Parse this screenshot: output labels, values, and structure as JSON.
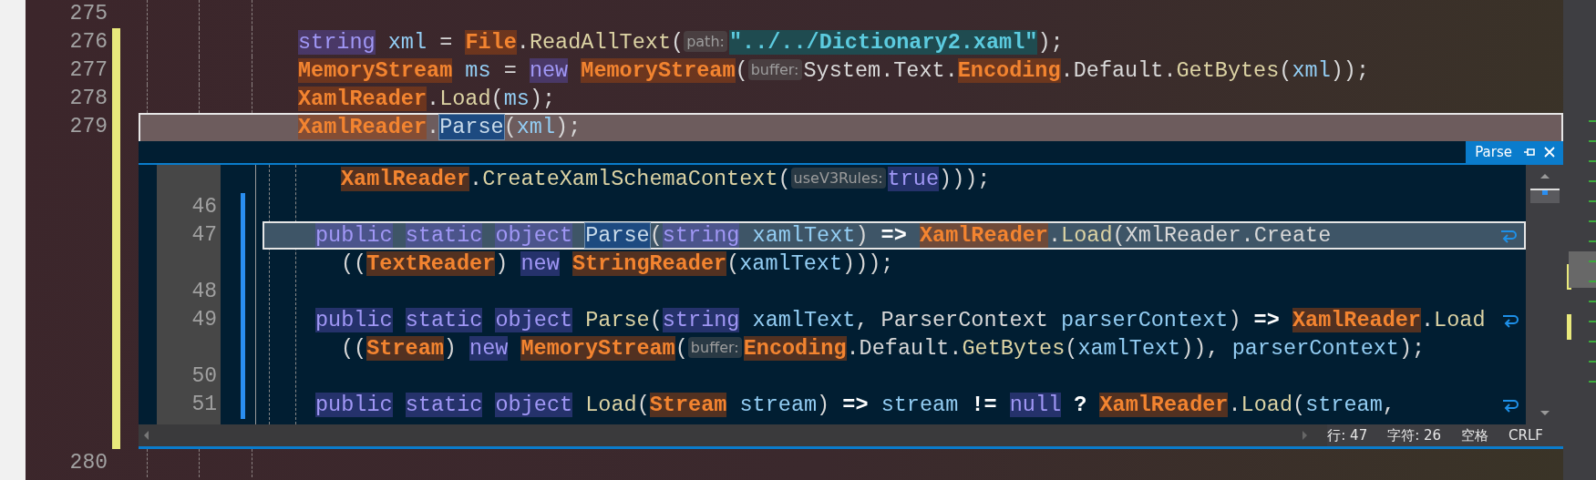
{
  "editor": {
    "lines": [
      {
        "number": "275",
        "changed": false,
        "selected": false
      },
      {
        "number": "276",
        "changed": true,
        "selected": false,
        "tokens": [
          {
            "text": "string ",
            "kind": "kw"
          },
          {
            "text": "xml",
            "kind": "var"
          },
          {
            "text": " = ",
            "kind": "plain"
          },
          {
            "text": "File",
            "kind": "type"
          },
          {
            "text": ".",
            "kind": "plain"
          },
          {
            "text": "ReadAllText",
            "kind": "method"
          },
          {
            "text": "(",
            "kind": "plain"
          },
          {
            "text": "path:",
            "kind": "hint"
          },
          {
            "text": "\"../../Dictionary2.xaml\"",
            "kind": "str"
          },
          {
            "text": ");",
            "kind": "plain"
          }
        ]
      },
      {
        "number": "277",
        "changed": true,
        "selected": false,
        "tokens": [
          {
            "text": "MemoryStream ",
            "kind": "type"
          },
          {
            "text": "ms",
            "kind": "var"
          },
          {
            "text": " = ",
            "kind": "plain"
          },
          {
            "text": "new ",
            "kind": "kw"
          },
          {
            "text": "MemoryStream",
            "kind": "type"
          },
          {
            "text": "(",
            "kind": "plain"
          },
          {
            "text": "buffer:",
            "kind": "hint"
          },
          {
            "text": "System.Text.",
            "kind": "plain"
          },
          {
            "text": "Encoding",
            "kind": "type"
          },
          {
            "text": ".Default.",
            "kind": "plain"
          },
          {
            "text": "GetBytes",
            "kind": "method"
          },
          {
            "text": "(",
            "kind": "plain"
          },
          {
            "text": "xml",
            "kind": "var"
          },
          {
            "text": "));",
            "kind": "plain"
          }
        ]
      },
      {
        "number": "278",
        "changed": true,
        "selected": false,
        "tokens": [
          {
            "text": "XamlReader",
            "kind": "type"
          },
          {
            "text": ".",
            "kind": "plain"
          },
          {
            "text": "Load",
            "kind": "method"
          },
          {
            "text": "(",
            "kind": "plain"
          },
          {
            "text": "ms",
            "kind": "var"
          },
          {
            "text": ");",
            "kind": "plain"
          }
        ]
      },
      {
        "number": "279",
        "changed": true,
        "selected": true,
        "tokens": [
          {
            "text": "XamlReader",
            "kind": "type"
          },
          {
            "text": ".",
            "kind": "plain"
          },
          {
            "text": "Parse",
            "kind": "ref"
          },
          {
            "text": "(",
            "kind": "plain"
          },
          {
            "text": "xml",
            "kind": "var"
          },
          {
            "text": ");",
            "kind": "plain"
          }
        ]
      }
    ],
    "peek": {
      "tab": {
        "label": "Parse"
      },
      "rows": [
        {
          "wrapped": true,
          "changed": false,
          "selected": false,
          "wraps": false,
          "tokens": [
            {
              "text": "XamlReader",
              "kind": "type"
            },
            {
              "text": ".",
              "kind": "plain"
            },
            {
              "text": "CreateXamlSchemaContext",
              "kind": "method"
            },
            {
              "text": "(",
              "kind": "plain"
            },
            {
              "text": "useV3Rules:",
              "kind": "hint"
            },
            {
              "text": "true",
              "kind": "kw"
            },
            {
              "text": ")));",
              "kind": "plain"
            }
          ]
        },
        {
          "number": "46",
          "changed": true,
          "selected": false
        },
        {
          "number": "47",
          "wrapped": false,
          "changed": true,
          "selected": true,
          "wraps": true,
          "tokens": [
            {
              "text": "public ",
              "kind": "kw"
            },
            {
              "text": "static ",
              "kind": "kw"
            },
            {
              "text": "object ",
              "kind": "kw"
            },
            {
              "text": "Parse",
              "kind": "ref"
            },
            {
              "text": "(",
              "kind": "plain"
            },
            {
              "text": "string ",
              "kind": "kw"
            },
            {
              "text": "xamlText",
              "kind": "var"
            },
            {
              "text": ") ",
              "kind": "plain"
            },
            {
              "text": "=> ",
              "kind": "op"
            },
            {
              "text": "XamlReader",
              "kind": "type"
            },
            {
              "text": ".",
              "kind": "plain"
            },
            {
              "text": "Load",
              "kind": "method"
            },
            {
              "text": "(XmlReader.Create",
              "kind": "plain"
            }
          ]
        },
        {
          "wrapped": true,
          "changed": true,
          "selected": false,
          "wraps": false,
          "tokens": [
            {
              "text": "((",
              "kind": "plain"
            },
            {
              "text": "TextReader",
              "kind": "type"
            },
            {
              "text": ") ",
              "kind": "plain"
            },
            {
              "text": "new ",
              "kind": "kw"
            },
            {
              "text": "StringReader",
              "kind": "type"
            },
            {
              "text": "(",
              "kind": "plain"
            },
            {
              "text": "xamlText",
              "kind": "var"
            },
            {
              "text": ")));",
              "kind": "plain"
            }
          ]
        },
        {
          "number": "48",
          "changed": true,
          "selected": false
        },
        {
          "number": "49",
          "wrapped": false,
          "changed": true,
          "selected": false,
          "wraps": true,
          "tokens": [
            {
              "text": "public ",
              "kind": "kw"
            },
            {
              "text": "static ",
              "kind": "kw"
            },
            {
              "text": "object ",
              "kind": "kw"
            },
            {
              "text": "Parse",
              "kind": "method"
            },
            {
              "text": "(",
              "kind": "plain"
            },
            {
              "text": "string ",
              "kind": "kw"
            },
            {
              "text": "xamlText",
              "kind": "var"
            },
            {
              "text": ", ParserContext ",
              "kind": "plain"
            },
            {
              "text": "parserContext",
              "kind": "var"
            },
            {
              "text": ") ",
              "kind": "plain"
            },
            {
              "text": "=> ",
              "kind": "op"
            },
            {
              "text": "XamlReader",
              "kind": "type"
            },
            {
              "text": ".",
              "kind": "plain"
            },
            {
              "text": "Load",
              "kind": "method"
            }
          ]
        },
        {
          "wrapped": true,
          "changed": true,
          "selected": false,
          "wraps": false,
          "tokens": [
            {
              "text": "((",
              "kind": "plain"
            },
            {
              "text": "Stream",
              "kind": "type"
            },
            {
              "text": ") ",
              "kind": "plain"
            },
            {
              "text": "new ",
              "kind": "kw"
            },
            {
              "text": "MemoryStream",
              "kind": "type"
            },
            {
              "text": "(",
              "kind": "plain"
            },
            {
              "text": "buffer:",
              "kind": "hint"
            },
            {
              "text": "Encoding",
              "kind": "type"
            },
            {
              "text": ".Default.",
              "kind": "plain"
            },
            {
              "text": "GetBytes",
              "kind": "method"
            },
            {
              "text": "(",
              "kind": "plain"
            },
            {
              "text": "xamlText",
              "kind": "var"
            },
            {
              "text": ")), ",
              "kind": "plain"
            },
            {
              "text": "parserContext",
              "kind": "var"
            },
            {
              "text": ");",
              "kind": "plain"
            }
          ]
        },
        {
          "number": "50",
          "changed": true,
          "selected": false
        },
        {
          "number": "51",
          "wrapped": false,
          "changed": true,
          "selected": false,
          "wraps": true,
          "tokens": [
            {
              "text": "public ",
              "kind": "kw"
            },
            {
              "text": "static ",
              "kind": "kw"
            },
            {
              "text": "object ",
              "kind": "kw"
            },
            {
              "text": "Load",
              "kind": "method"
            },
            {
              "text": "(",
              "kind": "plain"
            },
            {
              "text": "Stream ",
              "kind": "type"
            },
            {
              "text": "stream",
              "kind": "var"
            },
            {
              "text": ") ",
              "kind": "plain"
            },
            {
              "text": "=> ",
              "kind": "op"
            },
            {
              "text": "stream ",
              "kind": "var"
            },
            {
              "text": "!= ",
              "kind": "op"
            },
            {
              "text": "null ",
              "kind": "kw"
            },
            {
              "text": "? ",
              "kind": "op"
            },
            {
              "text": "XamlReader",
              "kind": "type"
            },
            {
              "text": ".",
              "kind": "plain"
            },
            {
              "text": "Load",
              "kind": "method"
            },
            {
              "text": "(",
              "kind": "plain"
            },
            {
              "text": "stream",
              "kind": "var"
            },
            {
              "text": ",",
              "kind": "plain"
            }
          ]
        }
      ],
      "status_bar": {
        "line": "行: 47",
        "char": "字符: 26",
        "indent": "空格",
        "line_ending": "CRLF"
      }
    },
    "after_lines": [
      {
        "number": "280",
        "changed": false,
        "selected": false
      }
    ]
  }
}
